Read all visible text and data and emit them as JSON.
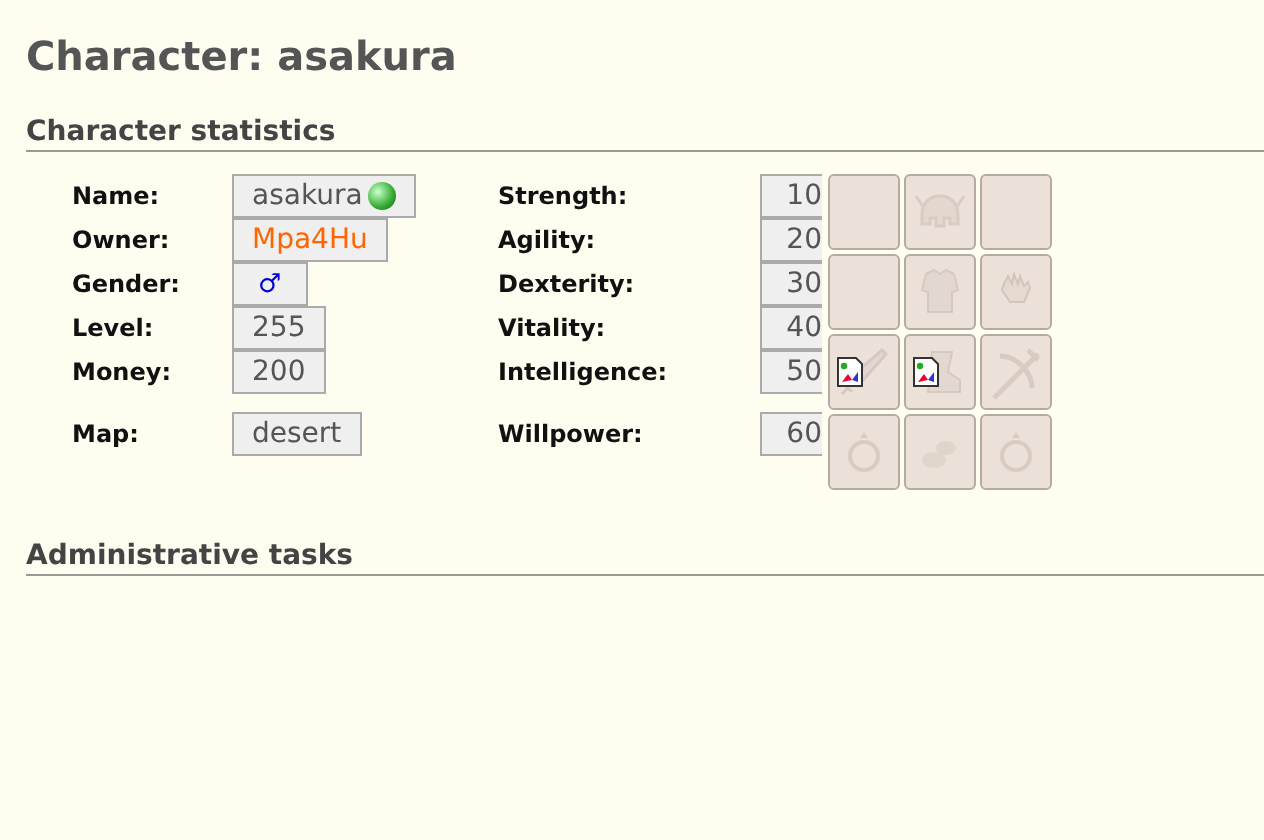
{
  "title": "Character: asakura",
  "sections": [
    {
      "heading": "Character statistics"
    },
    {
      "heading": "Administrative tasks"
    }
  ],
  "fields": [
    {
      "label": "Name:",
      "value": "asakura",
      "kind": "name",
      "online": true
    },
    {
      "label": "Owner:",
      "value": "Mpa4Hu",
      "kind": "link"
    },
    {
      "label": "Gender:",
      "value": "♂",
      "kind": "gender"
    },
    {
      "label": "Level:",
      "value": "255",
      "kind": "plain"
    },
    {
      "label": "Money:",
      "value": "200",
      "kind": "plain"
    },
    {
      "label": "Map:",
      "value": "desert",
      "kind": "plain"
    }
  ],
  "attributes": [
    {
      "label": "Strength:",
      "value": "10"
    },
    {
      "label": "Agility:",
      "value": "20"
    },
    {
      "label": "Dexterity:",
      "value": "30"
    },
    {
      "label": "Vitality:",
      "value": "40"
    },
    {
      "label": "Intelligence:",
      "value": "50"
    },
    {
      "label": "Willpower:",
      "value": "60"
    }
  ]
}
